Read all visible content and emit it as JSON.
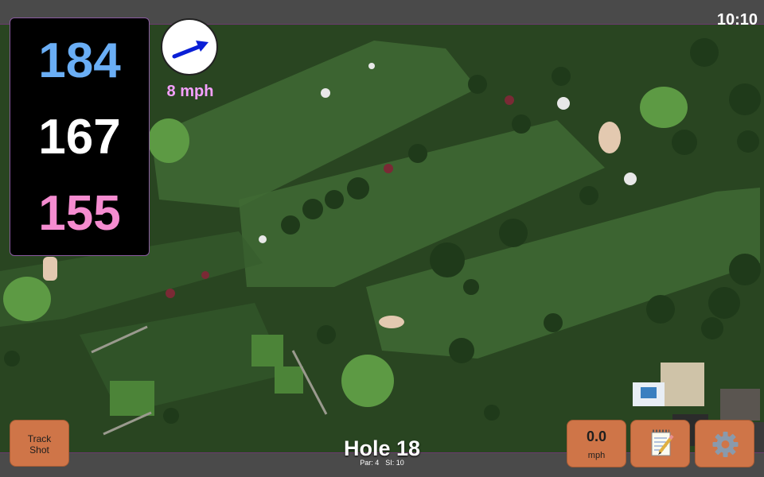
{
  "status_bar": {
    "time": "10:10"
  },
  "distances": {
    "back": {
      "value": "184",
      "color": "#6aaef5"
    },
    "middle": {
      "value": "167",
      "color": "#ffffff"
    },
    "front": {
      "value": "155",
      "color": "#f58cd0"
    }
  },
  "wind": {
    "speed": "8 mph",
    "speed_color": "#f5a0ff",
    "direction_icon": "arrow-icon",
    "arrow_color": "#0a1fd6"
  },
  "buttons": {
    "track_shot": {
      "line1": "Track",
      "line2": "Shot"
    },
    "speed": {
      "value": "0.0",
      "unit": "mph"
    },
    "notes_icon": "notepad-icon",
    "settings_icon": "gear-icon",
    "color": "#cf7548"
  },
  "hole": {
    "title": "Hole 18",
    "par": "Par: 4",
    "stroke_index": "SI: 10"
  },
  "map": {
    "type": "satellite",
    "fairway_color": "#3f6a34",
    "rough_color": "#2c4a24",
    "green_color": "#5d9a44",
    "bunker_color": "#e3c9b0"
  }
}
